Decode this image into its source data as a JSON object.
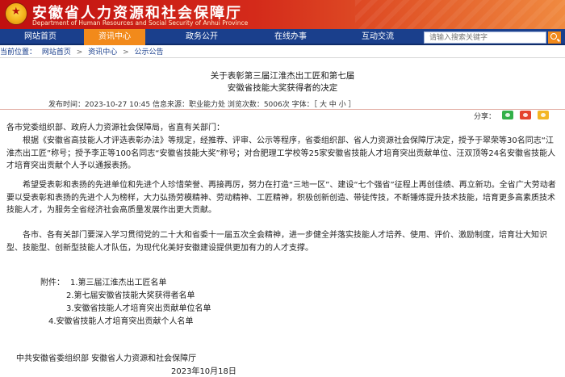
{
  "site": {
    "title": "安徽省人力资源和社会保障厅",
    "subtitle": "Department of Human Resources and Social Security of Anhui Province"
  },
  "nav": {
    "items": [
      "网站首页",
      "资讯中心",
      "政务公开",
      "在线办事",
      "互动交流"
    ],
    "active_index": 1,
    "search_placeholder": "请输入搜索关键字"
  },
  "breadcrumb": {
    "prefix": "当前位置：",
    "items": [
      "网站首页",
      "资讯中心",
      "公示公告"
    ],
    "separator": ">"
  },
  "article": {
    "title_line1": "关于表彰第三届江淮杰出工匠和第七届",
    "title_line2": "安徽省技能大奖获得者的决定",
    "meta": "发布时间：2023-10-27 10:45 信息来源：职业能力处 浏览次数：5006次 字体：［ 大 中 小 ］",
    "share_label": "分享：",
    "salutation": "各市党委组织部、政府人力资源社会保障局，省直有关部门：",
    "paragraphs": [
      "根据《安徽省高技能人才评选表彰办法》等规定，经推荐、评审、公示等程序，省委组织部、省人力资源社会保障厅决定，授予于翠荣等30名同志“江淮杰出工匠”称号；授予李正等100名同志“安徽省技能大奖”称号；对合肥理工学校等25家安徽省技能人才培育突出贡献单位、汪双顶等24名安徽省技能人才培育突出贡献个人予以通报表扬。",
      "希望受表彰和表扬的先进单位和先进个人珍惜荣誉、再接再厉，努力在打造“三地一区”、建设“七个强省”征程上再创佳绩、再立新功。全省广大劳动者要以受表彰和表扬的先进个人为榜样，大力弘扬劳模精神、劳动精神、工匠精神，积极创新创造、带徒传技，不断锤炼提升技术技能，培育更多高素质技术技能人才，为服务全省经济社会高质量发展作出更大贡献。",
      "各市、各有关部门要深入学习贯彻党的二十大和省委十一届五次全会精神，进一步健全并落实技能人才培养、使用、评价、激励制度，培育壮大知识型、技能型、创新型技能人才队伍，为现代化美好安徽建设提供更加有力的人才支撑。"
    ],
    "attachments_label": "附件：",
    "attachments": [
      "1.第三届江淮杰出工匠名单",
      "2.第七届安徽省技能大奖获得者名单",
      "3.安徽省技能人才培育突出贡献单位名单",
      "4.安徽省技能人才培育突出贡献个人名单"
    ],
    "signature": "中共安徽省委组织部     安徽省人力资源和社会保障厅",
    "date": "2023年10月18日"
  },
  "colors": {
    "banner": "#c01010",
    "nav": "#1a3f8c",
    "nav_active": "#f28a1b"
  }
}
